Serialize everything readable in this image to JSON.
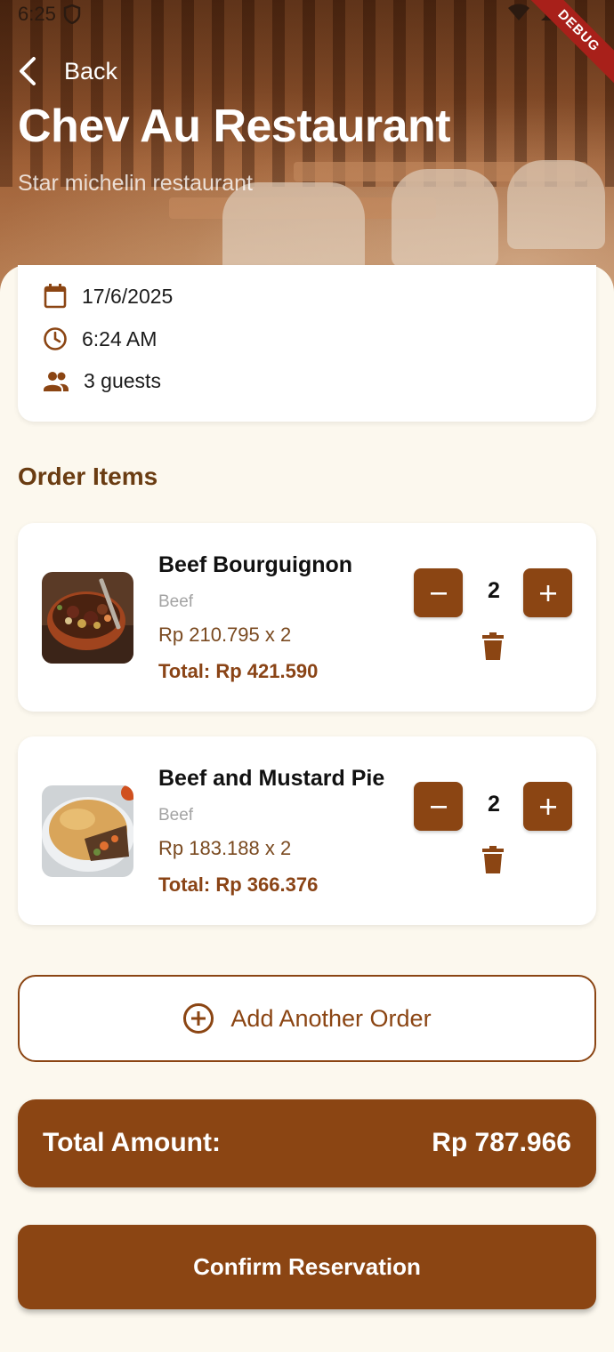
{
  "status_bar": {
    "time": "6:25"
  },
  "debug_banner": "DEBUG",
  "header": {
    "back_label": "Back",
    "title": "Chev Au Restaurant",
    "subtitle": "Star michelin restaurant"
  },
  "reservation": {
    "date": "17/6/2025",
    "time": "6:24 AM",
    "guests": "3 guests"
  },
  "orders_section_title": "Order Items",
  "orders": [
    {
      "name": "Beef Bourguignon",
      "category": "Beef",
      "price_line": "Rp 210.795 x 2",
      "total_line": "Total: Rp 421.590",
      "quantity": "2"
    },
    {
      "name": "Beef and Mustard Pie",
      "category": "Beef",
      "price_line": "Rp 183.188 x 2",
      "total_line": "Total: Rp 366.376",
      "quantity": "2"
    }
  ],
  "add_order_label": "Add Another Order",
  "total": {
    "label": "Total Amount:",
    "value": "Rp 787.966"
  },
  "confirm_label": "Confirm Reservation",
  "colors": {
    "primary": "#8b4513",
    "background": "#fcf8ee",
    "section_title": "#6a3c12"
  }
}
